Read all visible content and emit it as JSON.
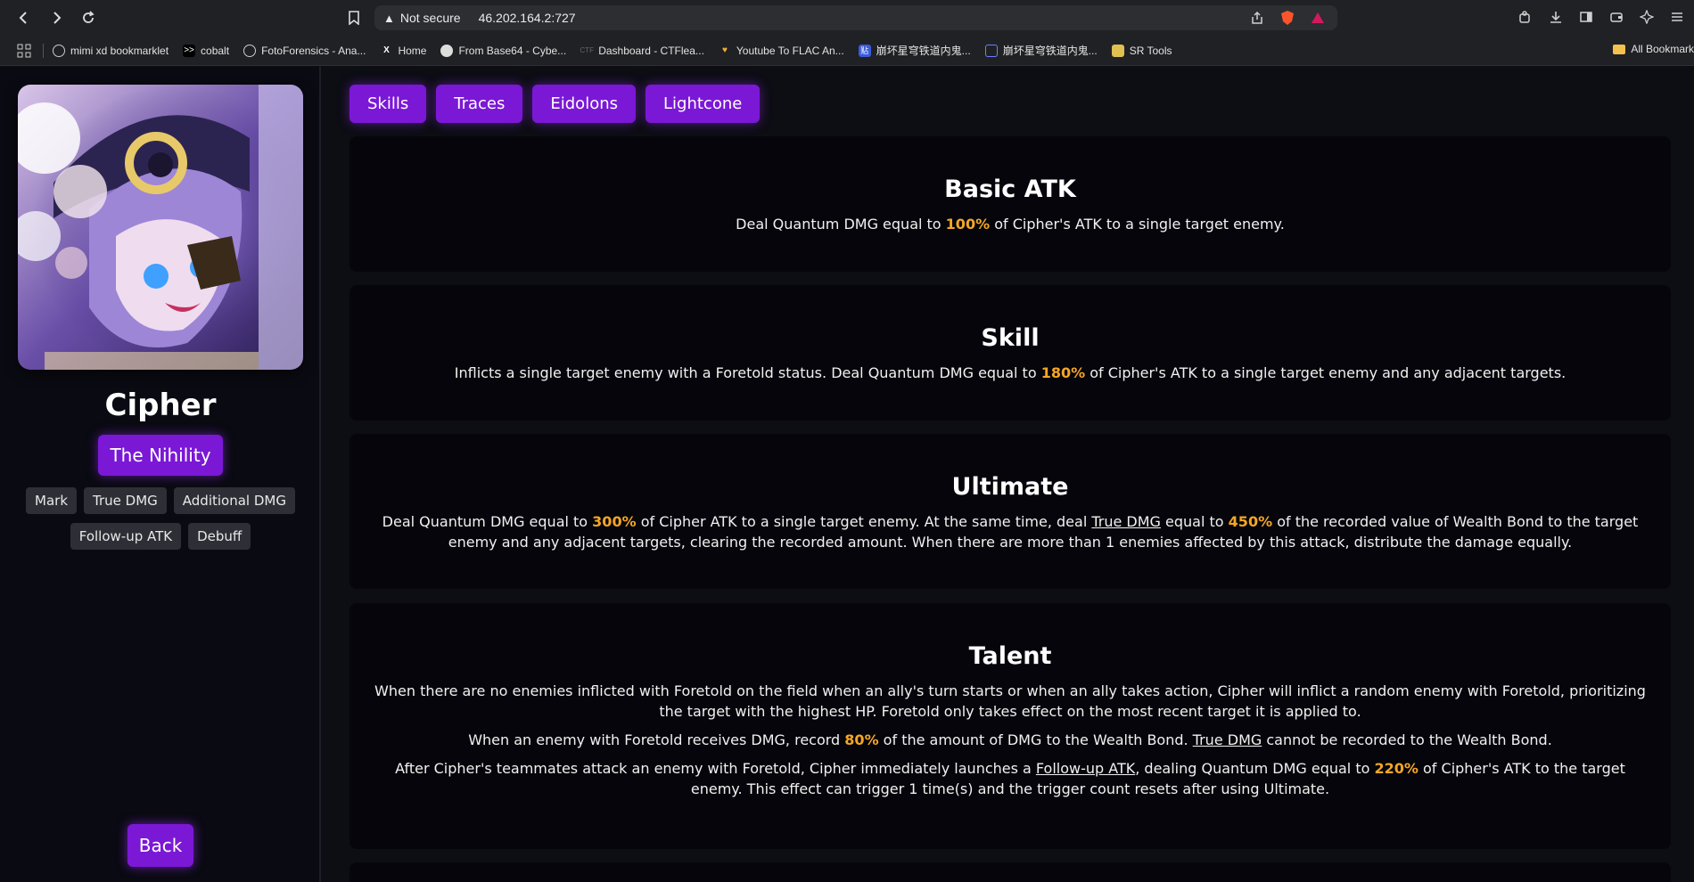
{
  "browser": {
    "security_label": "Not secure",
    "url": "46.202.164.2:727"
  },
  "bookmarks": {
    "items": [
      {
        "label": "mimi xd bookmarklet"
      },
      {
        "label": "cobalt"
      },
      {
        "label": "FotoForensics - Ana..."
      },
      {
        "label": "Home"
      },
      {
        "label": "From Base64 - Cybe..."
      },
      {
        "label": "Dashboard - CTFlea..."
      },
      {
        "label": "Youtube To FLAC An..."
      },
      {
        "label": "崩坏星穹铁道内鬼..."
      },
      {
        "label": "崩坏星穹铁道内鬼..."
      },
      {
        "label": "SR Tools"
      }
    ],
    "all_label": "All Bookmark"
  },
  "character": {
    "name": "Cipher",
    "path": "The Nihility",
    "tags": [
      "Mark",
      "True DMG",
      "Additional DMG",
      "Follow-up ATK",
      "Debuff"
    ],
    "back_label": "Back"
  },
  "tabs": [
    "Skills",
    "Traces",
    "Eidolons",
    "Lightcone"
  ],
  "skills": {
    "basic": {
      "title": "Basic ATK",
      "p1_a": "Deal Quantum DMG equal to ",
      "p1_v": "100%",
      "p1_b": " of Cipher's ATK to a single target enemy."
    },
    "skill": {
      "title": "Skill",
      "p1_a": "Inflicts a single target enemy with a Foretold status. Deal Quantum DMG equal to ",
      "p1_v": "180%",
      "p1_b": " of Cipher's ATK to a single target enemy and any adjacent targets."
    },
    "ultimate": {
      "title": "Ultimate",
      "p1_a": "Deal Quantum DMG equal to ",
      "p1_v1": "300%",
      "p1_b": " of Cipher ATK to a single target enemy. At the same time, deal ",
      "p1_link": "True DMG",
      "p1_c": " equal to ",
      "p1_v2": "450%",
      "p1_d": " of the recorded value of Wealth Bond to the target enemy and any adjacent targets, clearing the recorded amount. When there are more than 1 enemies affected by this attack, distribute the damage equally."
    },
    "talent": {
      "title": "Talent",
      "p1": "When there are no enemies inflicted with Foretold on the field when an ally's turn starts or when an ally takes action, Cipher will inflict a random enemy with Foretold, prioritizing the target with the highest HP. Foretold only takes effect on the most recent target it is applied to.",
      "p2_a": "When an enemy with Foretold receives DMG, record ",
      "p2_v": "80%",
      "p2_b": " of the amount of DMG to the Wealth Bond. ",
      "p2_link": "True DMG",
      "p2_c": " cannot be recorded to the Wealth Bond.",
      "p3_a": "After Cipher's teammates attack an enemy with Foretold, Cipher immediately launches a ",
      "p3_link": "Follow-up ATK",
      "p3_b": ", dealing Quantum DMG equal to ",
      "p3_v": "220%",
      "p3_c": " of Cipher's ATK to the target enemy. This effect can trigger 1 time(s) and the trigger count resets after using Ultimate."
    }
  },
  "colors": {
    "accent": "#7b18d6",
    "highlight": "#f5a623",
    "card_bg": "#05050b",
    "page_bg": "#0d0d14"
  }
}
